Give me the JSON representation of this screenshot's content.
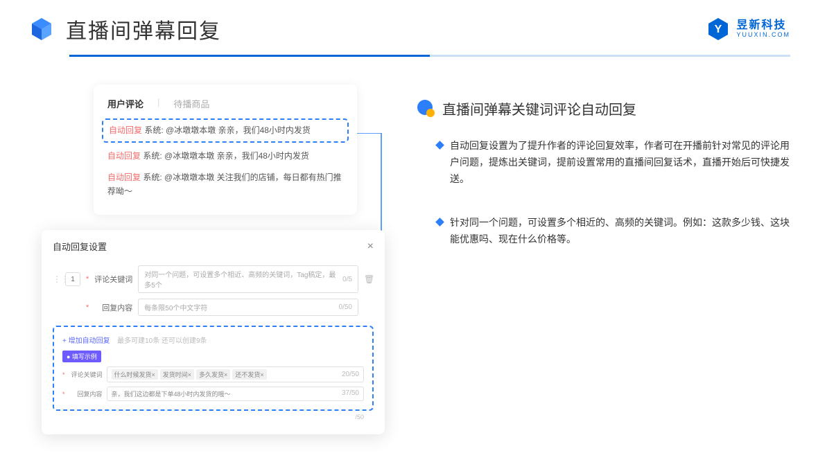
{
  "header": {
    "title": "直播间弹幕回复",
    "brand_name": "昱新科技",
    "brand_domain": "YUUXIN.COM"
  },
  "card1": {
    "tab_active": "用户评论",
    "tab_inactive": "待播商品",
    "comments": [
      {
        "tag": "自动回复",
        "sys": "系统:",
        "text": "@冰墩墩本墩 亲亲，我们48小时内发货"
      },
      {
        "tag": "自动回复",
        "sys": "系统:",
        "text": "@冰墩墩本墩 亲亲，我们48小时内发货"
      },
      {
        "tag": "自动回复",
        "sys": "系统:",
        "text": "@冰墩墩本墩 关注我们的店铺，每日都有热门推荐呦～"
      }
    ]
  },
  "card2": {
    "title": "自动回复设置",
    "seq": "1",
    "field1_label": "评论关键词",
    "field1_placeholder": "对同一个问题，可设置多个相近、高频的关键词，Tag稿定，最多5个",
    "field1_counter": "0/5",
    "field2_label": "回复内容",
    "field2_placeholder": "每条限50个中文字符",
    "field2_counter": "0/50",
    "add_link": "+ 增加自动回复",
    "add_hint": "最多可建10条 还可以创建9条",
    "example_badge": "● 填写示例",
    "ex_label1": "评论关键词",
    "ex_chips": [
      "什么时候发货×",
      "发货时间×",
      "多久发货×",
      "还不发货×"
    ],
    "ex_counter1": "20/50",
    "ex_label2": "回复内容",
    "ex_value2": "亲，我们这边都是下单48小时内发货的哦～",
    "ex_counter2": "37/50",
    "below_counter": "/50"
  },
  "right": {
    "section_title": "直播间弹幕关键词评论自动回复",
    "bullets": [
      "自动回复设置为了提升作者的评论回复效率，作者可在开播前针对常见的评论用户问题，提炼出关键词，提前设置常用的直播间回复话术，直播开始后可快捷发送。",
      "针对同一个问题，可设置多个相近的、高频的关键词。例如：这款多少钱、这块能优惠吗、现在什么价格等。"
    ]
  }
}
